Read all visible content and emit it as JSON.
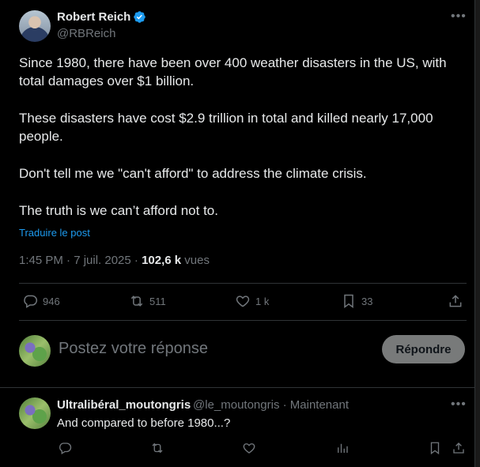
{
  "tweet": {
    "author_name": "Robert Reich",
    "handle": "@RBReich",
    "more_icon": "more-horizontal-icon",
    "paragraphs": [
      "Since 1980, there have been over 400 weather disasters in the US, with total damages over $1 billion.",
      "These disasters have cost $2.9 trillion in total and killed nearly 17,000 people.",
      "Don't tell me we \"can't afford\" to address the climate crisis.",
      "The truth is we can’t afford not to."
    ],
    "translate_label": "Traduire le post",
    "timestamp": "1:45 PM · 7 juil. 2025",
    "meta_separator": " · ",
    "views_count": "102,6 k",
    "views_label": " vues",
    "actions": {
      "replies": "946",
      "reposts": "511",
      "likes": "1 k",
      "bookmarks": "33"
    },
    "accent_color": "#1d9bf0"
  },
  "composer": {
    "placeholder": "Postez votre réponse",
    "reply_button_label": "Répondre"
  },
  "comment": {
    "author_name": "Ultralibéral_moutongris",
    "handle_time": "@le_moutongris · Maintenant",
    "text": "And compared to before 1980...?"
  }
}
